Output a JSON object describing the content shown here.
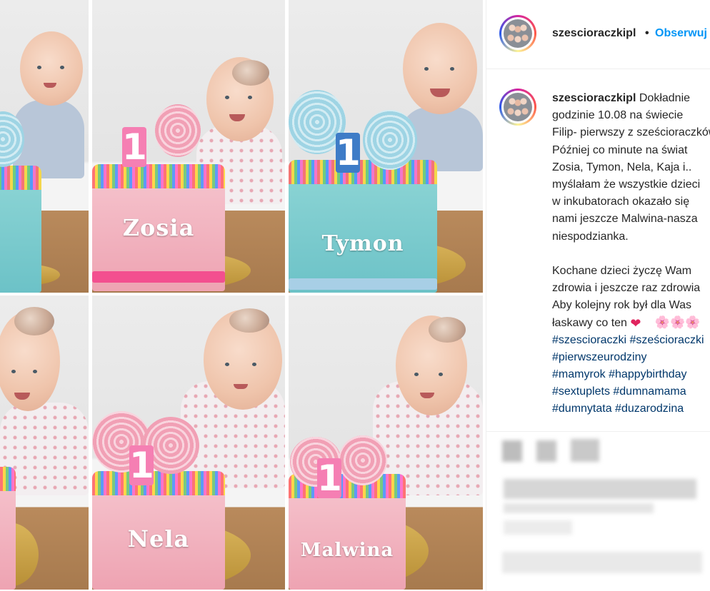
{
  "post": {
    "username": "szescioraczkipl",
    "separator": "•",
    "follow_label": "Obserwuj",
    "caption_lines": [
      "Dokładnie",
      "godzinie 10.08 na świecie",
      "Filip- pierwszy z sześcioraczków",
      "Później co minute na świat",
      "Zosia, Tymon, Nela, Kaja i..",
      "myślałam że wszystkie dzieci",
      "w inkubatorach okazało się",
      "nami jeszcze Malwina-nasza",
      "niespodzianka.",
      "",
      "Kochane dzieci życzę Wam",
      "zdrowia i jeszcze raz zdrowia",
      "Aby kolejny rok był dla Was",
      "łaskawy co ten"
    ],
    "emoji": {
      "heart": "❤",
      "blossoms": "🌸🌸🌸"
    },
    "hashtag_lines": [
      "#szescioraczki #sześcioraczki",
      "#pierwszeurodziny",
      "#mamyrok #happybirthday",
      "#sextuplets #dumnamama",
      "#dumnytata #duzarodzina"
    ]
  },
  "photos": [
    {
      "cake_name": "",
      "cake_color": "teal",
      "candle": ""
    },
    {
      "cake_name": "Zosia",
      "cake_color": "pink",
      "candle": "1"
    },
    {
      "cake_name": "Tymon",
      "cake_color": "teal",
      "candle": "1"
    },
    {
      "cake_name": "",
      "cake_color": "pink",
      "candle": ""
    },
    {
      "cake_name": "Nela",
      "cake_color": "pink",
      "candle": "1"
    },
    {
      "cake_name": "Malwina",
      "cake_color": "pink",
      "candle": "1"
    }
  ],
  "colors": {
    "link_blue": "#0095f6",
    "hashtag": "#00376b",
    "text": "#262626",
    "cake_pink": "#eea3b2",
    "cake_teal": "#6cc2c7"
  }
}
